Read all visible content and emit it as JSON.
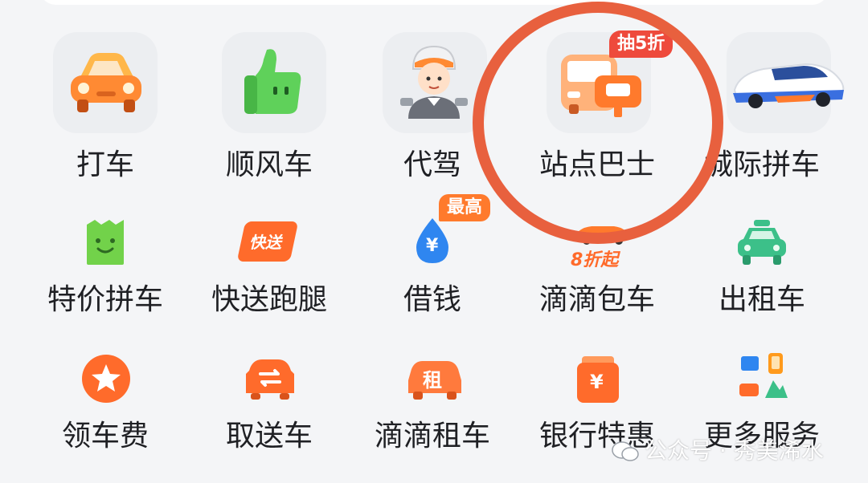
{
  "colors": {
    "accent_orange": "#ff7a2c",
    "badge_red": "#ee4a3c",
    "highlight_circle": "#e8603e",
    "green": "#5fd15a",
    "teal": "#3cc089",
    "blue": "#2f86f0"
  },
  "row1": [
    {
      "label": "打车",
      "icon": "taxi-car-icon"
    },
    {
      "label": "顺风车",
      "icon": "thumbs-up-icon"
    },
    {
      "label": "代驾",
      "icon": "driver-avatar-icon"
    },
    {
      "label": "站点巴士",
      "icon": "station-bus-icon",
      "badge": "抽5折"
    },
    {
      "label": "城际拼车",
      "icon": "intercity-car-icon"
    }
  ],
  "row2": [
    {
      "label": "特价拼车",
      "icon": "smile-bag-icon"
    },
    {
      "label": "快送跑腿",
      "icon": "express-delivery-icon",
      "icon_text": "快送"
    },
    {
      "label": "借钱",
      "icon": "yuan-drop-icon",
      "icon_text": "¥",
      "badge": "最高"
    },
    {
      "label": "滴滴包车",
      "icon": "charter-car-icon",
      "promo": "8折起"
    },
    {
      "label": "出租车",
      "icon": "taxi-icon"
    }
  ],
  "row3": [
    {
      "label": "领车费",
      "icon": "star-badge-icon"
    },
    {
      "label": "取送车",
      "icon": "car-swap-icon"
    },
    {
      "label": "滴滴租车",
      "icon": "rental-car-icon",
      "icon_text": "租"
    },
    {
      "label": "银行特惠",
      "icon": "bank-wallet-icon",
      "icon_text": "¥"
    },
    {
      "label": "更多服务",
      "icon": "more-services-icon"
    }
  ],
  "watermark": {
    "text": "公众号 · 秀美浠水"
  }
}
